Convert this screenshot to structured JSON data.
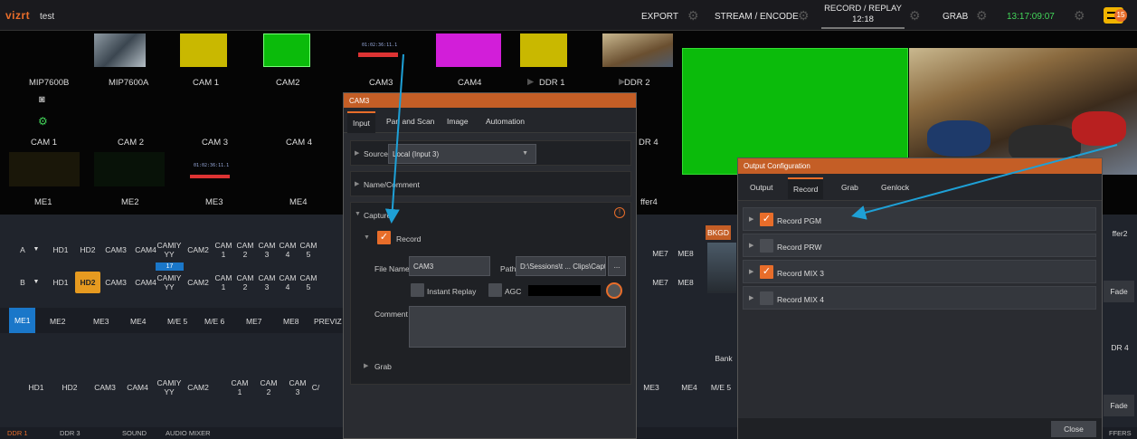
{
  "topbar": {
    "logo": "vizrt",
    "session": "test",
    "export": "EXPORT",
    "stream": "STREAM / ENCODE",
    "record_title": "RECORD / REPLAY",
    "record_time": "12:18",
    "grab": "GRAB",
    "clock": "13:17:09:07",
    "notify_count": "15"
  },
  "monitors": {
    "row1": [
      "MIP7600B",
      "MIP7600A",
      "CAM 1",
      "CAM2",
      "CAM3",
      "CAM4",
      "DDR 1",
      "DDR 2"
    ],
    "row2": [
      "CAM 1",
      "CAM 2",
      "CAM 3",
      "CAM 4",
      "DR 4"
    ],
    "row3": [
      "ME1",
      "ME2",
      "ME3",
      "ME4",
      "ffer4"
    ],
    "timecode": "01:02:36:11.1"
  },
  "switcher": {
    "row_a_label": "A",
    "row_b_label": "B",
    "buttons": [
      "HD1",
      "HD2",
      "CAM3",
      "CAM4",
      "CAMIY YY",
      "CAM2",
      "CAM 1",
      "CAM 2",
      "CAM 3",
      "CAM 4",
      "CAM 5"
    ],
    "bus_badge": "17",
    "right_buttons": [
      "ME7",
      "ME8"
    ],
    "bkgd": "BKGD",
    "buffer2": "ffer2",
    "fade": "Fade",
    "ddr4": "DR 4",
    "bank": "Bank",
    "row_c": [
      "HD1",
      "HD2",
      "CAM3",
      "CAM4",
      "CAMIY YY",
      "CAM2",
      "CAM 1",
      "CAM 2",
      "CAM 3",
      "C/"
    ],
    "row_c_right": [
      "ME3",
      "ME4",
      "M/E 5"
    ],
    "fade2": "Fade",
    "ffers": "FFERS"
  },
  "delegate_tabs": [
    "ME1",
    "ME2",
    "ME3",
    "ME4",
    "M/E 5",
    "M/E 6",
    "ME7",
    "ME8",
    "PREVIZ"
  ],
  "bottom_tabs": [
    "DDR 1",
    "DDR 3",
    "SOUND",
    "AUDIO MIXER"
  ],
  "cam_dialog": {
    "title": "CAM3",
    "tabs": [
      "Input",
      "Pan and Scan",
      "Image",
      "Automation"
    ],
    "source_label": "Source",
    "source_value": "Local (Input 3)",
    "name_comment": "Name/Comment",
    "capture": "Capture",
    "record": "Record",
    "file_name_label": "File Name",
    "file_name_value": "CAM3",
    "path_label": "Path",
    "path_value": "D:\\Sessions\\t ... Clips\\Capt",
    "path_btn": "...",
    "instant_replay": "Instant Replay",
    "agc": "AGC",
    "comment_label": "Comment",
    "grab": "Grab",
    "info_glyph": "!"
  },
  "output_dialog": {
    "title": "Output Configuration",
    "tabs": [
      "Output",
      "Record",
      "Grab",
      "Genlock"
    ],
    "rows": [
      {
        "label": "Record PGM",
        "checked": true
      },
      {
        "label": "Record PRW",
        "checked": false
      },
      {
        "label": "Record MIX 3",
        "checked": true
      },
      {
        "label": "Record MIX 4",
        "checked": false
      }
    ],
    "close": "Close"
  },
  "colors": {
    "accent": "#e86d2a",
    "callout": "#1ea0d6",
    "clock": "#43d65a",
    "pgm": "#0bbb0b"
  }
}
